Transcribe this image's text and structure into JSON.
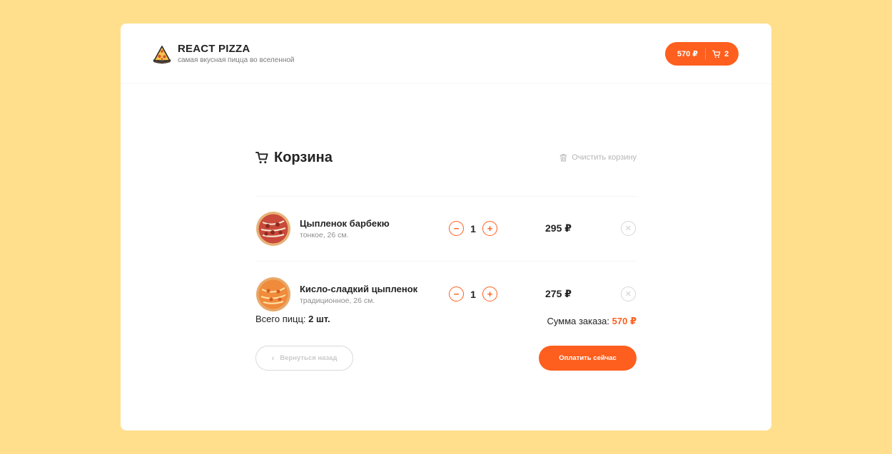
{
  "header": {
    "logo_title": "REACT PIZZA",
    "logo_subtitle": "самая вкусная пицца во вселенной",
    "cart_button": {
      "price": "570 ₽",
      "count": "2"
    }
  },
  "cart": {
    "title": "Корзина",
    "clear_label": "Очистить корзину",
    "items": [
      {
        "name": "Цыпленок барбекю",
        "description": "тонкое, 26 см.",
        "count": "1",
        "price": "295 ₽",
        "minus": "−",
        "plus": "+"
      },
      {
        "name": "Кисло-сладкий цыпленок",
        "description": "традиционное, 26 см.",
        "count": "1",
        "price": "275 ₽",
        "minus": "−",
        "plus": "+"
      }
    ],
    "total_count_label": "Всего пицц: ",
    "total_count_value": "2 шт.",
    "total_sum_label": "Сумма заказа: ",
    "total_sum_value": "570 ₽",
    "back_label": "Вернуться назад",
    "pay_label": "Оплатить сейчас"
  },
  "colors": {
    "accent": "#fe5f1e",
    "background": "#ffdf8c"
  }
}
